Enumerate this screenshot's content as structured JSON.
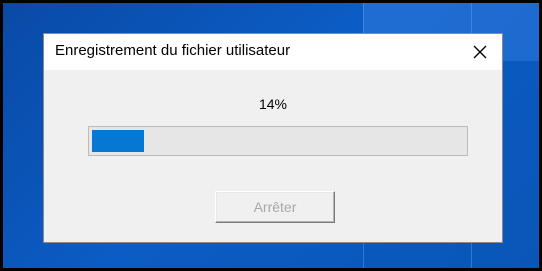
{
  "dialog": {
    "title": "Enregistrement du fichier utilisateur",
    "progress_label": "14%",
    "progress_value": 0.14,
    "stop_button_label": "Arrêter",
    "stop_button_enabled": false,
    "close_icon": "close-icon"
  },
  "colors": {
    "progress_fill": "#0678d4",
    "progress_track": "#e6e6e6",
    "dialog_background": "#f0f0f0",
    "titlebar_background": "#ffffff",
    "desktop_background": "#0b5cc4",
    "disabled_text": "#a8a8a8"
  }
}
